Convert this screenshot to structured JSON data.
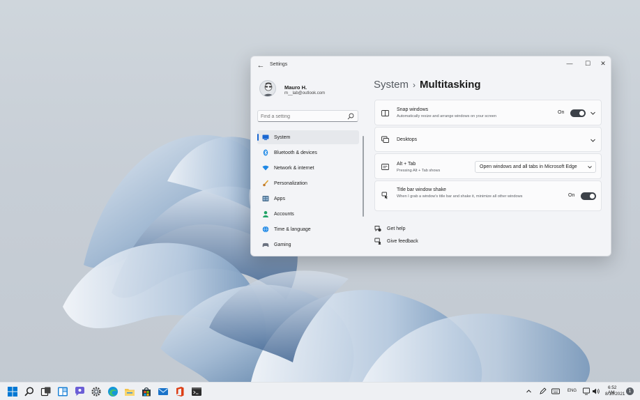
{
  "window": {
    "title": "Settings",
    "back_icon": "arrow-left-icon",
    "controls": [
      "minimize-icon",
      "maximize-icon",
      "close-icon"
    ]
  },
  "profile": {
    "name": "Mauro H.",
    "email": "m__lab@outlook.com",
    "avatar_icon": "avatar-icon"
  },
  "search": {
    "placeholder": "Find a setting",
    "icon": "search-icon"
  },
  "nav": {
    "active_index": 0,
    "items": [
      {
        "label": "System",
        "icon": "system-icon",
        "color": "#1967d2"
      },
      {
        "label": "Bluetooth & devices",
        "icon": "bluetooth-icon",
        "color": "#1f88e5"
      },
      {
        "label": "Network & internet",
        "icon": "wifi-icon",
        "color": "#1f88e5"
      },
      {
        "label": "Personalization",
        "icon": "brush-icon",
        "color": "#e0a030"
      },
      {
        "label": "Apps",
        "icon": "apps-icon",
        "color": "#4a6d8c"
      },
      {
        "label": "Accounts",
        "icon": "accounts-icon",
        "color": "#21a366"
      },
      {
        "label": "Time & language",
        "icon": "globe-icon",
        "color": "#1f88e5"
      },
      {
        "label": "Gaming",
        "icon": "gaming-icon",
        "color": "#6b7280"
      }
    ]
  },
  "breadcrumb": {
    "parent": "System",
    "separator": "›",
    "current": "Multitasking"
  },
  "cards": {
    "snap": {
      "title": "Snap windows",
      "desc": "Automatically resize and arrange windows on your screen",
      "state": "On",
      "icon": "snap-icon"
    },
    "desktops": {
      "title": "Desktops",
      "icon": "desktops-icon"
    },
    "alttab": {
      "title": "Alt + Tab",
      "desc": "Pressing Alt + Tab shows",
      "value": "Open windows and all tabs in Microsoft Edge",
      "icon": "alt-tab-icon"
    },
    "shake": {
      "title": "Title bar window shake",
      "desc": "When I grab a window's title bar and shake it, minimize all other windows",
      "state": "On",
      "icon": "shake-icon"
    }
  },
  "links": {
    "help": {
      "label": "Get help",
      "icon": "help-icon"
    },
    "feedback": {
      "label": "Give feedback",
      "icon": "feedback-icon"
    }
  },
  "taskbar": {
    "apps": [
      "start-icon",
      "search-icon",
      "task-view-icon",
      "widgets-icon",
      "chat-icon",
      "settings-icon",
      "edge-icon",
      "file-explorer-icon",
      "store-icon",
      "mail-icon",
      "office-icon",
      "terminal-icon"
    ],
    "tray": {
      "lang": "ENG",
      "time": "6:52 AM",
      "date": "8/10/2021",
      "notifications": "1"
    }
  },
  "colors": {
    "accent": "#1967d2",
    "toggle_on": "#3c4148",
    "window_bg": "#f3f4f7",
    "card_bg": "#fbfbfc"
  }
}
